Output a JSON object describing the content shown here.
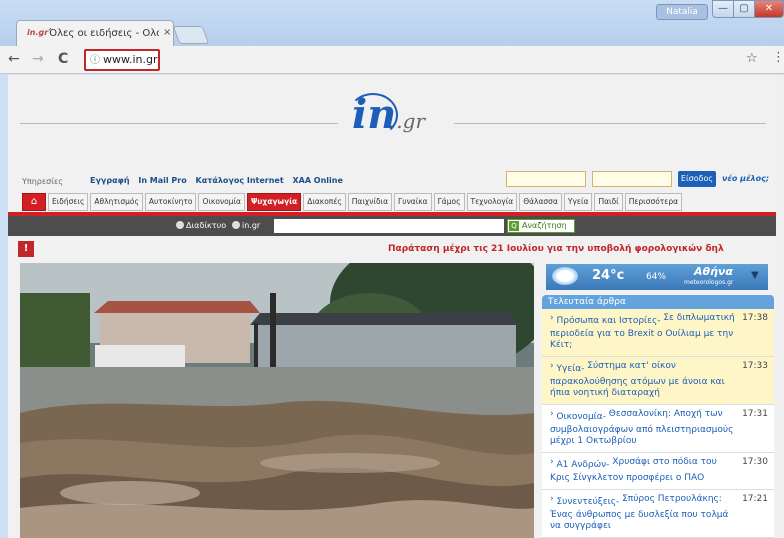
{
  "browser": {
    "tab_title": "Όλες οι ειδήσεις - ΟλοκΛ",
    "tab_close": "×",
    "favicon_text": "in.gr",
    "user_name": "Natalia",
    "window_buttons": {
      "min": "—",
      "max": "▢",
      "close": "✕"
    },
    "nav": {
      "back": "←",
      "forward": "→",
      "reload": "C"
    },
    "url": "www.in.gr",
    "info_glyph": "ⓘ",
    "star": "☆",
    "menu": "⋮"
  },
  "site": {
    "logo_main": "in",
    "logo_suffix": ".gr",
    "services_label": "Υπηρεσίες",
    "service_links": [
      "Εγγραφή",
      "In Mail Pro",
      "Κατάλογος Internet",
      "ΧΑΑ Online"
    ],
    "login_label": "Είσοδος",
    "new_member": "νέο μέλος;",
    "home_glyph": "⌂",
    "categories": [
      "Ειδήσεις",
      "Αθλητισμός",
      "Αυτοκίνητο",
      "Οικονομία",
      "Ψυχαγωγία",
      "Διακοπές",
      "Παιχνίδια",
      "Γυναίκα",
      "Γάμος",
      "Τεχνολογία",
      "Θάλασσα",
      "Υγεία",
      "Παιδί",
      "Περισσότερα"
    ],
    "active_category": "Ψυχαγωγία",
    "search_option_web": "Διαδίκτυο",
    "search_option_site": "in.gr",
    "search_button": "Αναζήτηση",
    "ticker_icon": "!",
    "ticker_text": "Παράταση μέχρι τις 21 Ιουλίου για την υποβολή φορολογικών δηλ",
    "weather": {
      "temp": "24°c",
      "humidity": "64%",
      "city": "Αθήνα",
      "provider": "meteorologos.gr",
      "arrow": "▼"
    },
    "latest_heading": "Τελευταία άρθρα",
    "latest": [
      {
        "category": "Πρόσωπα και Ιστορίες-",
        "title": "Σε διπλωματική περιοδεία για το Brexit ο Ουίλιαμ με την Κέιτ;",
        "time": "17:38",
        "highlight": true
      },
      {
        "category": "Υγεία-",
        "title": "Σύστημα κατ' οίκον παρακολούθησης ατόμων με άνοια και ήπια νοητική διαταραχή",
        "time": "17:33",
        "highlight": true
      },
      {
        "category": "Οικονομία-",
        "title": "Θεσσαλονίκη: Αποχή των συμβολαιογράφων από πλειστηριασμούς μέχρι 1 Οκτωβρίου",
        "time": "17:31",
        "highlight": false
      },
      {
        "category": "Α1 Ανδρών-",
        "title": "Χρυσάφι στο πόδια του Κρις Σίνγκλετον προσφέρει ο ΠΑΟ",
        "time": "17:30",
        "highlight": false
      },
      {
        "category": "Συνεντεύξεις-",
        "title": "Σπύρος Πετρουλάκης: Ένας άνθρωπος με δυσλεξία που τολμά να συγγράφει",
        "time": "17:21",
        "highlight": false
      }
    ]
  }
}
